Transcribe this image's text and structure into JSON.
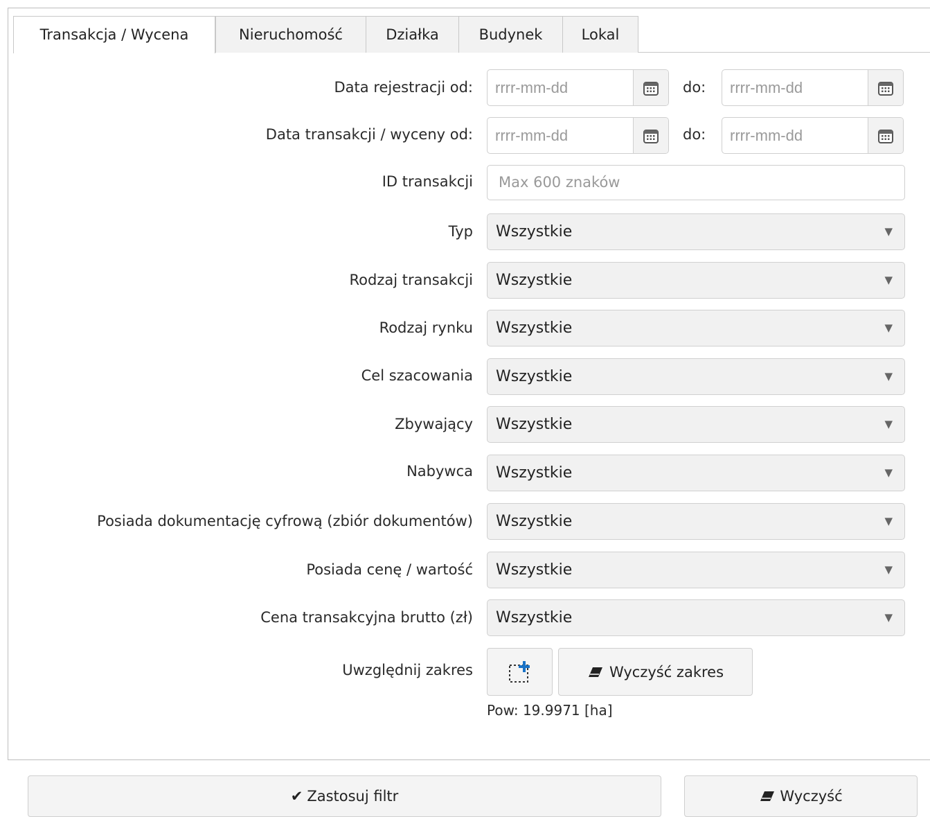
{
  "tabs": [
    {
      "label": "Transakcja / Wycena",
      "active": true
    },
    {
      "label": "Nieruchomość",
      "active": false
    },
    {
      "label": "Działka",
      "active": false
    },
    {
      "label": "Budynek",
      "active": false
    },
    {
      "label": "Lokal",
      "active": false
    }
  ],
  "form": {
    "reg_date": {
      "label": "Data rejestracji od:",
      "from_placeholder": "rrrr-mm-dd",
      "to_label": "do:",
      "to_placeholder": "rrrr-mm-dd"
    },
    "trans_date": {
      "label": "Data transakcji / wyceny od:",
      "from_placeholder": "rrrr-mm-dd",
      "to_label": "do:",
      "to_placeholder": "rrrr-mm-dd"
    },
    "id": {
      "label": "ID transakcji",
      "placeholder": "Max 600 znaków"
    },
    "selects": [
      {
        "label": "Typ",
        "value": "Wszystkie"
      },
      {
        "label": "Rodzaj transakcji",
        "value": "Wszystkie"
      },
      {
        "label": "Rodzaj rynku",
        "value": "Wszystkie"
      },
      {
        "label": "Cel szacowania",
        "value": "Wszystkie"
      },
      {
        "label": "Zbywający",
        "value": "Wszystkie"
      },
      {
        "label": "Nabywca",
        "value": "Wszystkie"
      },
      {
        "label": "Posiada dokumentację cyfrową (zbiór dokumentów)",
        "value": "Wszystkie"
      },
      {
        "label": "Posiada cenę / wartość",
        "value": "Wszystkie"
      },
      {
        "label": "Cena transakcyjna brutto (zł)",
        "value": "Wszystkie"
      }
    ],
    "range": {
      "label": "Uwzględnij zakres",
      "clear_label": "Wyczyść zakres",
      "area_text": "Pow: 19.9971 [ha]"
    }
  },
  "actions": {
    "apply_label": "Zastosuj filtr",
    "clear_label": "Wyczyść"
  },
  "icons": {
    "select_arrow": "▼",
    "check": "✔",
    "eraser": "eraser-icon",
    "calendar": "calendar-icon",
    "select_area": "select-area-plus-icon"
  },
  "colors": {
    "border": "#cfcfcf",
    "select_bg": "#f1f1f1",
    "accent_blue": "#1a73c7"
  }
}
